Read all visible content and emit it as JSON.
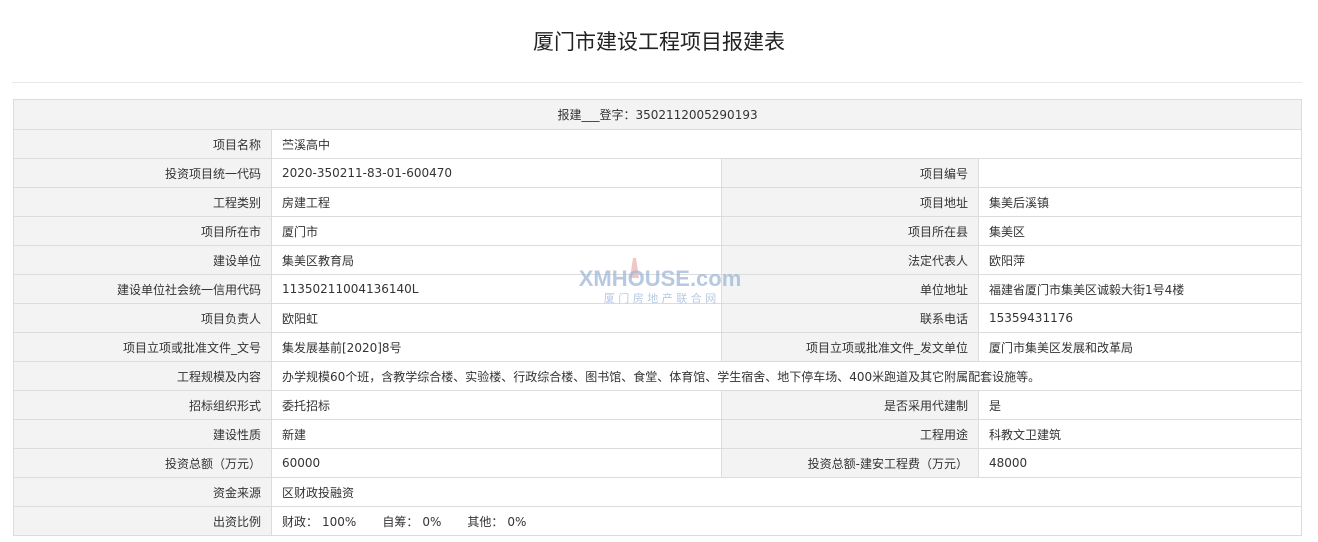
{
  "page": {
    "title": "厦门市建设工程项目报建表"
  },
  "header": {
    "registration": "报建___登字：3502112005290193"
  },
  "rows": {
    "project_name": {
      "label": "项目名称",
      "value": "苎溪高中"
    },
    "investment_code": {
      "label": "投资项目统一代码",
      "value": "2020-350211-83-01-600470"
    },
    "project_number": {
      "label": "项目编号",
      "value": ""
    },
    "engineering_category": {
      "label": "工程类别",
      "value": "房建工程"
    },
    "project_address": {
      "label": "项目地址",
      "value": "集美后溪镇"
    },
    "project_city": {
      "label": "项目所在市",
      "value": "厦门市"
    },
    "project_county": {
      "label": "项目所在县",
      "value": "集美区"
    },
    "construction_unit": {
      "label": "建设单位",
      "value": "集美区教育局"
    },
    "legal_representative": {
      "label": "法定代表人",
      "value": "欧阳萍"
    },
    "credit_code": {
      "label": "建设单位社会统一信用代码",
      "value": "11350211004136140L"
    },
    "unit_address": {
      "label": "单位地址",
      "value": "福建省厦门市集美区诚毅大街1号4楼"
    },
    "project_leader": {
      "label": "项目负责人",
      "value": "欧阳虹"
    },
    "contact_phone": {
      "label": "联系电话",
      "value": "15359431176"
    },
    "approval_doc_number": {
      "label": "项目立项或批准文件_文号",
      "value": "集发展基前[2020]8号"
    },
    "approval_doc_issuer": {
      "label": "项目立项或批准文件_发文单位",
      "value": "厦门市集美区发展和改革局"
    },
    "scale_content": {
      "label": "工程规模及内容",
      "value": "办学规模60个班，含教学综合楼、实验楼、行政综合楼、图书馆、食堂、体育馆、学生宿舍、地下停车场、400米跑道及其它附属配套设施等。"
    },
    "bidding_form": {
      "label": "招标组织形式",
      "value": "委托招标"
    },
    "agent_construction": {
      "label": "是否采用代建制",
      "value": "是"
    },
    "construction_nature": {
      "label": "建设性质",
      "value": "新建"
    },
    "project_use": {
      "label": "工程用途",
      "value": "科教文卫建筑"
    },
    "total_investment": {
      "label": "投资总额（万元）",
      "value": "60000"
    },
    "construction_cost": {
      "label": "投资总额-建安工程费（万元）",
      "value": "48000"
    },
    "funding_source": {
      "label": "资金来源",
      "value": "区财政投融资"
    },
    "funding_ratio": {
      "label": "出资比例",
      "finance_label": "财政：",
      "finance_value": "100%",
      "self_label": "自筹：",
      "self_value": "0%",
      "other_label": "其他：",
      "other_value": "0%"
    }
  },
  "watermark": {
    "logo_text": "XMHOUSE.com",
    "subtitle": "厦 门 房 地 产 联 合 网"
  },
  "colors": {
    "label_bg": "#f3f3f3",
    "border": "#dcdcdc",
    "watermark_blue": "#9fb8d8",
    "watermark_red": "#e6a0a0"
  }
}
